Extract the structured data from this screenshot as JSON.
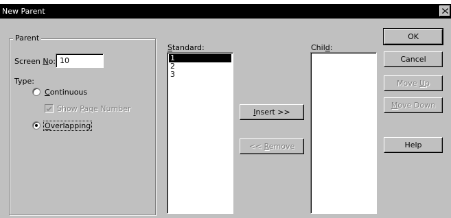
{
  "window": {
    "title": "New Parent",
    "close_glyph": "✕"
  },
  "parent_group": {
    "legend": "Parent",
    "screen_no": {
      "label_pre": "Screen ",
      "label_mnemonic": "N",
      "label_post": "o:",
      "value": "10"
    },
    "type_label": "Type:",
    "continuous": {
      "mnemonic": "C",
      "rest": "ontinuous",
      "selected": false
    },
    "show_page_number": {
      "pre": "Show ",
      "mnemonic": "P",
      "post": "age Number",
      "checked": true,
      "enabled": false
    },
    "overlapping": {
      "mnemonic": "O",
      "rest": "verlapping",
      "selected": true
    }
  },
  "standard": {
    "label_mnemonic": "S",
    "label_rest": "tandard:",
    "items": [
      "1",
      "2",
      "3"
    ],
    "selected_index": 0
  },
  "child": {
    "label_pre": "Chil",
    "label_mnemonic": "d",
    "label_post": ":",
    "items": []
  },
  "buttons": {
    "insert": {
      "mnemonic": "I",
      "rest": "nsert >>",
      "enabled": true
    },
    "remove": {
      "pre": "<< ",
      "mnemonic": "R",
      "rest": "emove",
      "enabled": false
    },
    "ok": "OK",
    "cancel": "Cancel",
    "move_up": {
      "pre": "Move ",
      "mnemonic": "U",
      "rest": "p",
      "enabled": false
    },
    "move_down": {
      "mnemonic": "M",
      "rest": "ove Down",
      "enabled": false
    },
    "help": "Help"
  }
}
